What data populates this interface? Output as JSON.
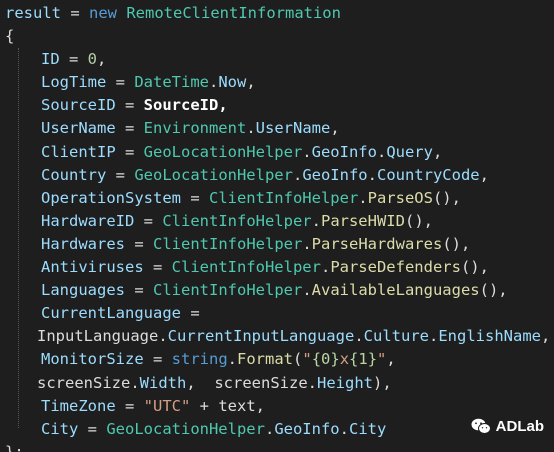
{
  "code": {
    "l01": {
      "a": "result",
      "b": " = ",
      "c": "new",
      "d": " ",
      "e": "RemoteClientInformation"
    },
    "l02": {
      "a": "{"
    },
    "l03": {
      "a": "ID",
      "b": " = ",
      "c": "0",
      "d": ","
    },
    "l04": {
      "a": "LogTime",
      "b": " = ",
      "c": "DateTime",
      "d": ".",
      "e": "Now",
      "f": ","
    },
    "l05": {
      "a": "SourceID",
      "b": " = ",
      "c": "SourceID",
      "d": ","
    },
    "l06": {
      "a": "UserName",
      "b": " = ",
      "c": "Environment",
      "d": ".",
      "e": "UserName",
      "f": ","
    },
    "l07": {
      "a": "ClientIP",
      "b": " = ",
      "c": "GeoLocationHelper",
      "d": ".",
      "e": "GeoInfo",
      "f": ".",
      "g": "Query",
      "h": ","
    },
    "l08": {
      "a": "Country",
      "b": " = ",
      "c": "GeoLocationHelper",
      "d": ".",
      "e": "GeoInfo",
      "f": ".",
      "g": "CountryCode",
      "h": ","
    },
    "l09": {
      "a": "OperationSystem",
      "b": " = ",
      "c": "ClientInfoHelper",
      "d": ".",
      "e": "ParseOS",
      "f": "(),"
    },
    "l10": {
      "a": "HardwareID",
      "b": " = ",
      "c": "ClientInfoHelper",
      "d": ".",
      "e": "ParseHWID",
      "f": "(),"
    },
    "l11": {
      "a": "Hardwares",
      "b": " = ",
      "c": "ClientInfoHelper",
      "d": ".",
      "e": "ParseHardwares",
      "f": "(),"
    },
    "l12": {
      "a": "Antiviruses",
      "b": " = ",
      "c": "ClientInfoHelper",
      "d": ".",
      "e": "ParseDefenders",
      "f": "(),"
    },
    "l13": {
      "a": "Languages",
      "b": " = ",
      "c": "ClientInfoHelper",
      "d": ".",
      "e": "AvailableLanguages",
      "f": "(),"
    },
    "l14": {
      "a": "CurrentLanguage",
      "b": " ="
    },
    "l15": {
      "a": "InputLanguage",
      "b": ".",
      "c": "CurrentInputLanguage",
      "d": ".",
      "e": "Culture",
      "f": ".",
      "g": "EnglishName",
      "h": ","
    },
    "l16": {
      "a": "MonitorSize",
      "b": " = ",
      "c": "string",
      "d": ".",
      "e": "Format",
      "f": "(",
      "g": "\"",
      "h": "{0}",
      "i": "x",
      "j": "{1}",
      "k": "\"",
      "l": ","
    },
    "l17": {
      "a": "screenSize",
      "b": ".",
      "c": "Width",
      "d": ",  ",
      "e": "screenSize",
      "f": ".",
      "g": "Height",
      "h": "),"
    },
    "l18": {
      "a": "TimeZone",
      "b": " = ",
      "c": "\"UTC\"",
      "d": " + text,"
    },
    "l19": {
      "a": "City",
      "b": " = ",
      "c": "GeoLocationHelper",
      "d": ".",
      "e": "GeoInfo",
      "f": ".",
      "g": "City"
    },
    "l20": {
      "a": "};"
    }
  },
  "watermark": {
    "label": "ADLab",
    "icon": "wechat-icon"
  },
  "colors": {
    "background": "#1e1e1e",
    "keyword": "#569cd6",
    "type": "#4ec9b0",
    "property": "#9cdcfe",
    "method": "#dcdcaa",
    "string": "#d69d85",
    "number": "#b5cea8",
    "plain": "#dcdcdc"
  }
}
